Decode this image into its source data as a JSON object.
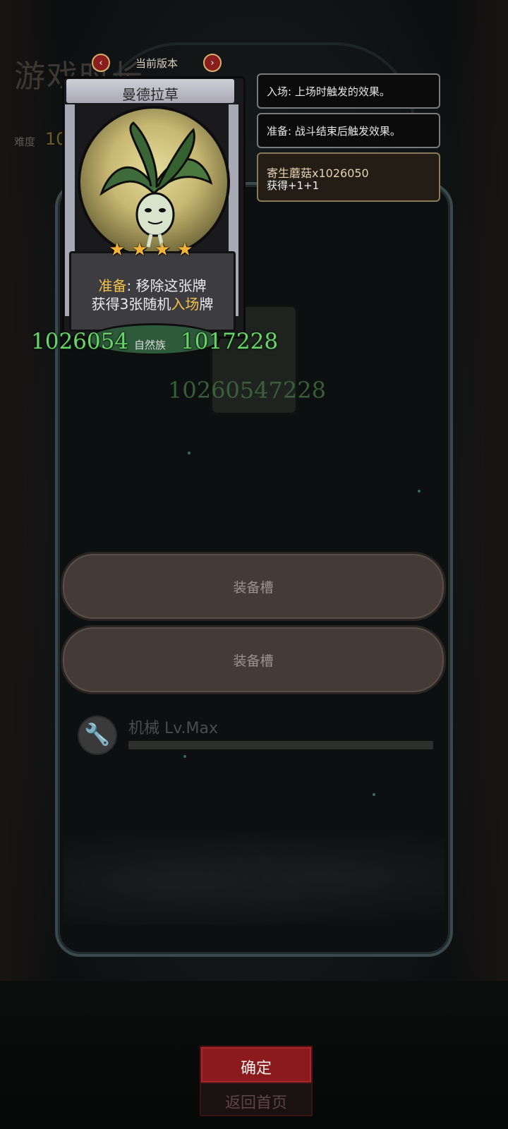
{
  "background": {
    "page_title": "游戏时长",
    "difficulty_label": "难度",
    "difficulty_value": "10"
  },
  "version_selector": {
    "label": "当前版本",
    "prev_icon": "chevron-left-icon",
    "next_icon": "chevron-right-icon"
  },
  "card": {
    "name": "曼德拉草",
    "stars": 4,
    "star_glyph": "★",
    "description": {
      "line1_keyword": "准备",
      "line1_text": ": 移除这张牌",
      "line2_prefix": "获得3张随机",
      "line2_keyword": "入场",
      "line2_suffix": "牌"
    },
    "attack": "1026054",
    "tribe": "自然族",
    "health": "1017228"
  },
  "ghost_card": {
    "stats": "10260547228"
  },
  "tooltips": [
    {
      "text": "入场: 上场时触发的效果。"
    },
    {
      "text": "准备: 战斗结束后触发效果。"
    },
    {
      "title": "寄生蘑菇x1026050",
      "body": "获得+1+1"
    }
  ],
  "equipment_slots": [
    {
      "label": "装备槽"
    },
    {
      "label": "装备槽"
    }
  ],
  "mechanical": {
    "icon": "wrench-icon",
    "label": "机械 Lv.Max"
  },
  "buttons": {
    "confirm": "确定",
    "home": "返回首页"
  },
  "colors": {
    "keyword": "#f0c14b",
    "stat_green": "#6bd36b",
    "confirm_red": "#8b1a1d"
  }
}
